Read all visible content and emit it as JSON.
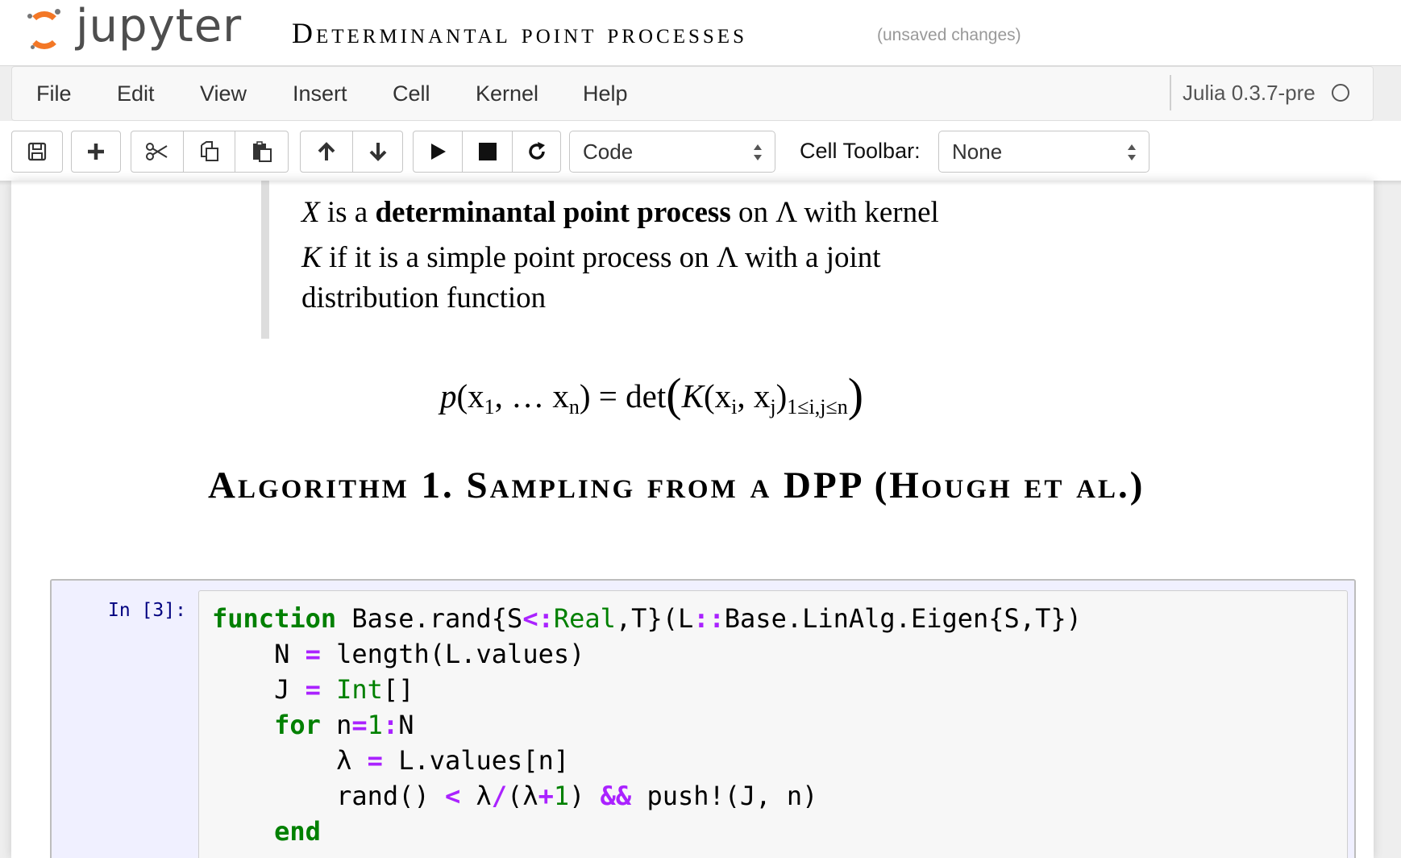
{
  "header": {
    "logo_text": "jupyter",
    "notebook_title": "Determinantal point processes",
    "save_status": "(unsaved changes)"
  },
  "menubar": {
    "items": [
      "File",
      "Edit",
      "View",
      "Insert",
      "Cell",
      "Kernel",
      "Help"
    ],
    "kernel_name": "Julia 0.3.7-pre",
    "kernel_status_icon": "circle-outline-icon"
  },
  "toolbar": {
    "buttons": [
      "save-icon",
      "plus-icon",
      "cut-icon",
      "copy-icon",
      "paste-icon",
      "arrow-up-icon",
      "arrow-down-icon",
      "play-icon",
      "stop-icon",
      "restart-icon"
    ],
    "cell_type_value": "Code",
    "cell_toolbar_label": "Cell Toolbar:",
    "cell_toolbar_value": "None"
  },
  "markdown": {
    "line1": {
      "var": "X",
      "t1": " is a ",
      "bold": "determinantal point process",
      "t2": " on Λ with kernel"
    },
    "line2": {
      "var": "K",
      "t1": " if it is a simple point process on Λ with a joint"
    },
    "line3": "distribution function",
    "equation": {
      "lhs_p": "p",
      "lhs_open": "(x",
      "lhs_sub1": "1",
      "lhs_mid": ", … x",
      "lhs_subn": "n",
      "lhs_close": ") = det",
      "lparen": "(",
      "K": "K",
      "args_open": "(x",
      "sub_i": "i",
      "comma": ", x",
      "sub_j": "j",
      "args_close": ")",
      "range": "1≤i,j≤n",
      "rparen": ")"
    },
    "heading": "Algorithm 1. Sampling from a DPP (Hough et al.)"
  },
  "code_cell": {
    "prompt": "In [3]:",
    "lines": [
      "function Base.rand{S<:Real,T}(L::Base.LinAlg.Eigen{S,T})",
      "    N = length(L.values)",
      "    J = Int[]",
      "    for n=1:N",
      "        λ = L.values[n]",
      "        rand() < λ/(λ+1) && push!(J, n)",
      "    end"
    ]
  },
  "colors": {
    "accent_orange": "#f37726",
    "code_keyword": "#008000",
    "code_operator": "#aa22ff",
    "prompt_blue": "#000080"
  }
}
